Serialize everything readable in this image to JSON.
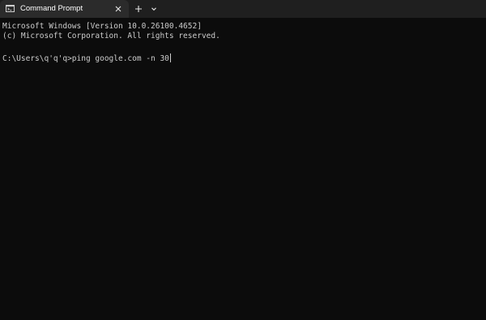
{
  "tab": {
    "title": "Command Prompt",
    "icon": "terminal-icon",
    "close_icon": "close-icon"
  },
  "toolbar": {
    "new_tab_icon": "plus-icon",
    "dropdown_icon": "chevron-down-icon"
  },
  "terminal": {
    "lines": [
      "Microsoft Windows [Version 10.0.26100.4652]",
      "(c) Microsoft Corporation. All rights reserved.",
      "",
      "C:\\Users\\q'q'q>ping google.com -n 30"
    ]
  },
  "colors": {
    "background": "#0c0c0c",
    "titlebar": "#1f1f1f",
    "active_tab": "#2b2b2b",
    "text": "#cccccc"
  }
}
